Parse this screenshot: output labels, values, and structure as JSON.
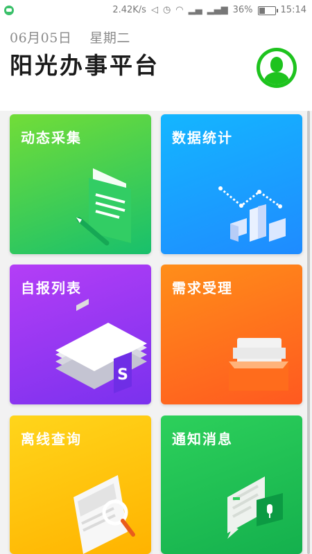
{
  "status_bar": {
    "speed": "2.42K/s",
    "battery": "36%",
    "time": "15:14"
  },
  "header": {
    "date": "06月05日",
    "weekday": "星期二",
    "title": "阳光办事平台"
  },
  "cards": [
    {
      "label": "动态采集",
      "color_from": "#6fdc3a",
      "color_to": "#1bc16a",
      "icon": "document-pencil-icon"
    },
    {
      "label": "数据统计",
      "color_from": "#12b9ff",
      "color_to": "#1e8cff",
      "icon": "bar-chart-icon"
    },
    {
      "label": "自报列表",
      "color_from": "#b23df5",
      "color_to": "#7b33f0",
      "icon": "stacked-papers-icon"
    },
    {
      "label": "需求受理",
      "color_from": "#ff8a1a",
      "color_to": "#ff5a1f",
      "icon": "inbox-tray-icon"
    },
    {
      "label": "离线查询",
      "color_from": "#ffd21a",
      "color_to": "#ffb300",
      "icon": "magnifier-document-icon"
    },
    {
      "label": "通知消息",
      "color_from": "#2ccf5a",
      "color_to": "#14b24f",
      "icon": "chat-bubble-icon"
    }
  ]
}
